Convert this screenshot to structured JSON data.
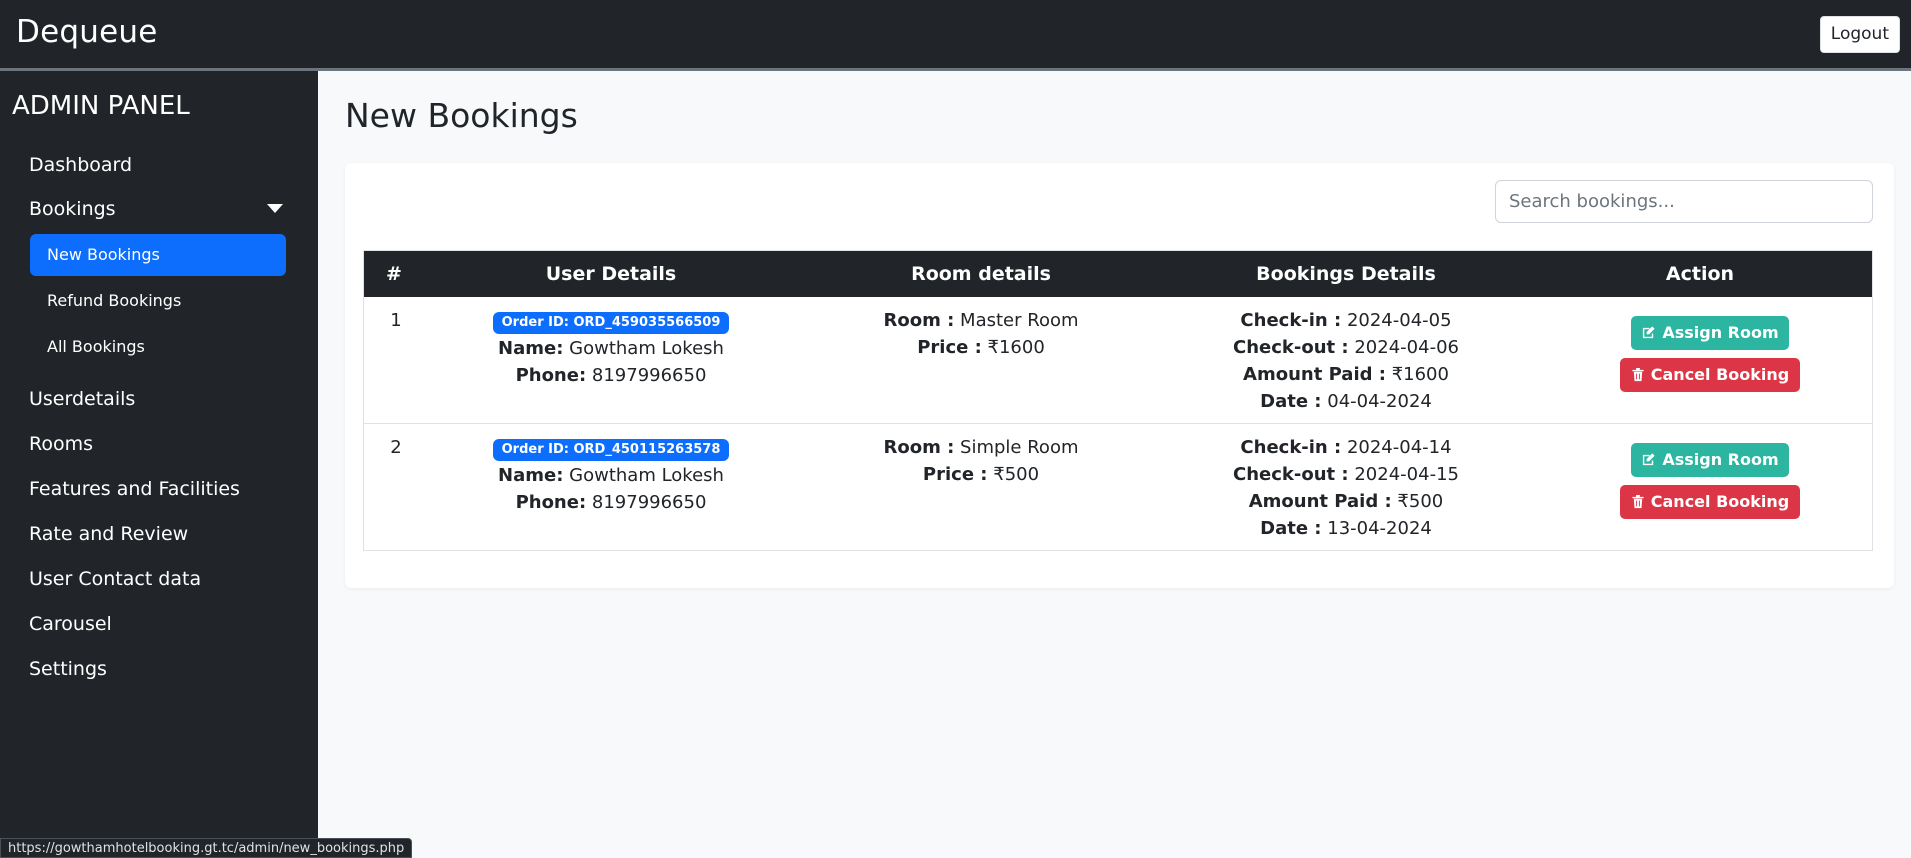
{
  "navbar": {
    "brand": "Dequeue",
    "logout_label": "Logout"
  },
  "sidebar": {
    "title": "ADMIN PANEL",
    "items": [
      {
        "label": "Dashboard"
      },
      {
        "label": "Bookings"
      },
      {
        "label": "Userdetails"
      },
      {
        "label": "Rooms"
      },
      {
        "label": "Features and Facilities"
      },
      {
        "label": "Rate and Review"
      },
      {
        "label": "User Contact data"
      },
      {
        "label": "Carousel"
      },
      {
        "label": "Settings"
      }
    ],
    "booking_sub": [
      {
        "label": "New Bookings",
        "active": true
      },
      {
        "label": "Refund Bookings"
      },
      {
        "label": "All Bookings"
      }
    ]
  },
  "main": {
    "title": "New Bookings",
    "search_placeholder": "Search bookings...",
    "columns": [
      "#",
      "User Details",
      "Room details",
      "Bookings Details",
      "Action"
    ],
    "labels": {
      "name": "Name:",
      "phone": "Phone:",
      "room": "Room :",
      "price": "Price :",
      "checkin": "Check-in :",
      "checkout": "Check-out :",
      "amount": "Amount Paid :",
      "date": "Date :"
    },
    "rows": [
      {
        "num": "1",
        "order_id": "Order ID: ORD_459035566509",
        "name": "Gowtham Lokesh",
        "phone": "8197996650",
        "room": "Master Room",
        "price": "₹1600",
        "checkin": "2024-04-05",
        "checkout": "2024-04-06",
        "amount": "₹1600",
        "date": "04-04-2024"
      },
      {
        "num": "2",
        "order_id": "Order ID: ORD_450115263578",
        "name": "Gowtham Lokesh",
        "phone": "8197996650",
        "room": "Simple Room",
        "price": "₹500",
        "checkin": "2024-04-14",
        "checkout": "2024-04-15",
        "amount": "₹500",
        "date": "13-04-2024"
      }
    ],
    "actions": {
      "assign": "Assign Room",
      "cancel": "Cancel Booking"
    }
  },
  "status_url": "https://gowthamhotelbooking.gt.tc/admin/new_bookings.php",
  "colors": {
    "dark": "#212529",
    "primary": "#0d6efd",
    "teal": "#2cb5a0",
    "danger": "#dc3545"
  }
}
